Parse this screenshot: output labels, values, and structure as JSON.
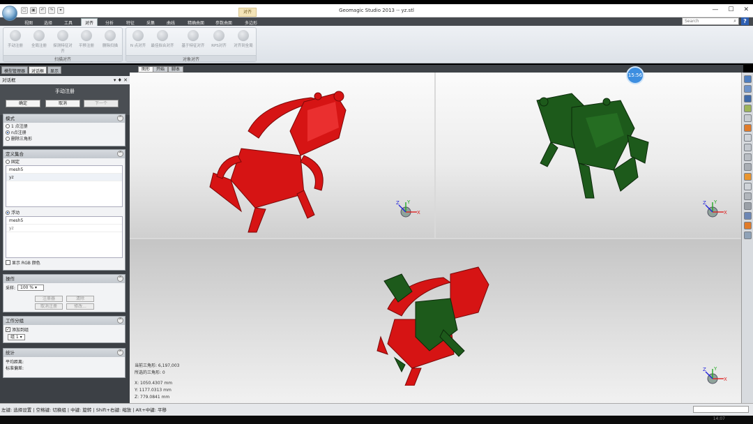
{
  "window": {
    "title": "Geomagic Studio 2013 -- yz.stl",
    "context_tab": "对齐",
    "controls": [
      "—",
      "☐",
      "✕"
    ]
  },
  "quick_access": [
    "▢",
    "▣",
    "↶",
    "↷",
    "▾"
  ],
  "ribbon": {
    "tabs": [
      "视图",
      "选择",
      "工具",
      "对齐",
      "分析",
      "特征",
      "采集",
      "曲线",
      "精确曲面",
      "参数曲面",
      "多边形"
    ],
    "active_tab": "对齐",
    "search_placeholder": "Search",
    "help_label": "?",
    "groups": [
      {
        "label": "扫描对齐",
        "buttons": [
          "手动注册",
          "全局注册",
          "探测特征对齐",
          "平移注册",
          "删除扫描"
        ]
      },
      {
        "label": "对象对齐",
        "buttons": [
          "N\n点对齐",
          "最佳拟合对齐",
          "基于特征对齐",
          "RPS对齐",
          "对齐到全局"
        ]
      }
    ]
  },
  "panel_tabs": [
    "模型管理器",
    "对话框",
    "显示"
  ],
  "active_panel_tab": "对话框",
  "dialog": {
    "title": "对话框",
    "title_controls": "▾ ♦ ✕",
    "command": "手动注册",
    "ok_label": "确定",
    "cancel_label": "取消",
    "next_label": "下一个",
    "mode": {
      "header": "模式",
      "options": [
        "1 点注册",
        "n点注册",
        "删除三角形"
      ],
      "selected": "n点注册"
    },
    "define_set": {
      "header": "定义集合",
      "fixed_label": "固定",
      "fixed_items": [
        "mesh5",
        "yz"
      ],
      "floating_label": "浮动",
      "floating_items": [
        "mesh5",
        "yz"
      ],
      "show_rgb_label": "显示 RGB 颜色"
    },
    "operation": {
      "header": "操作",
      "sampling_label": "采样:",
      "sampling_value": "100 %",
      "buttons": [
        "注册器",
        "清除",
        "取消注册",
        "修改..."
      ]
    },
    "work_group": {
      "header": "工作分组",
      "add_group_label": "添加到组",
      "group_value": "组 1"
    },
    "stats": {
      "header": "统计",
      "avg_distance_label": "平均距离:",
      "std_dev_label": "标准偏差:"
    }
  },
  "viewport": {
    "tabs": [
      "图形",
      "开始",
      "脚本"
    ],
    "active_tab": "图形",
    "timer": "15:56",
    "stats": {
      "triangles_label": "当前三角形: 6,197,003",
      "selected_label": "所选的三角形: 0",
      "x": "X:   1050.4307 mm",
      "y": "Y:   1177.0313 mm",
      "z": "Z:   779.0841 mm"
    },
    "axis_labels": {
      "x": "X",
      "y": "Y",
      "z": "Z"
    }
  },
  "colors": {
    "fixed_model": "#d61414",
    "floating_model": "#1d5a1b",
    "accent": "#3d8ee0"
  },
  "status": {
    "hint": "左键: 选择设置 | 空格键: 切换组 | 中键: 旋转 | Shift+右键: 缩放 | Alt+中键: 平移"
  },
  "taskbar_clock": "14:07"
}
